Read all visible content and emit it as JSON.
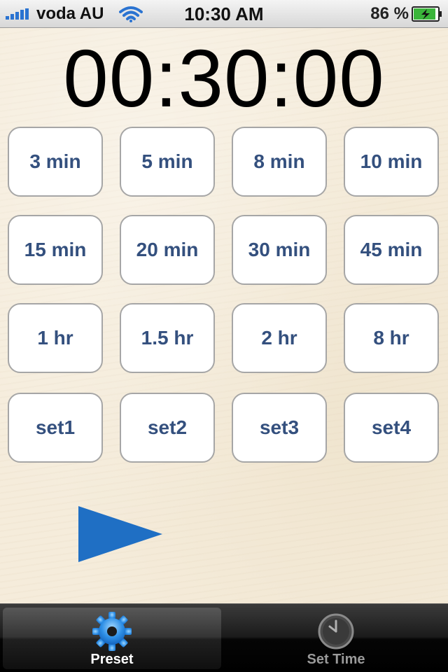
{
  "status_bar": {
    "carrier": "voda AU",
    "time": "10:30 AM",
    "battery_percent": "86 %",
    "signal_icon": "signal-bars-icon",
    "wifi_icon": "wifi-icon",
    "battery_icon": "battery-charging-icon"
  },
  "timer": {
    "display": "00:30:00"
  },
  "presets": {
    "row1": [
      "3 min",
      "5 min",
      "8 min",
      "10 min"
    ],
    "row2": [
      "15 min",
      "20 min",
      "30 min",
      "45 min"
    ],
    "row3": [
      "1 hr",
      "1.5 hr",
      "2 hr",
      "8 hr"
    ],
    "row4": [
      "set1",
      "set2",
      "set3",
      "set4"
    ]
  },
  "controls": {
    "play_icon": "play-icon",
    "play_color": "#1f6fc4"
  },
  "tab_bar": {
    "tabs": [
      {
        "label": "Preset",
        "icon": "gear-icon",
        "selected": true
      },
      {
        "label": "Set Time",
        "icon": "clock-icon",
        "selected": false
      }
    ]
  },
  "colors": {
    "button_text": "#34507e",
    "background": "#f5ecdb"
  }
}
